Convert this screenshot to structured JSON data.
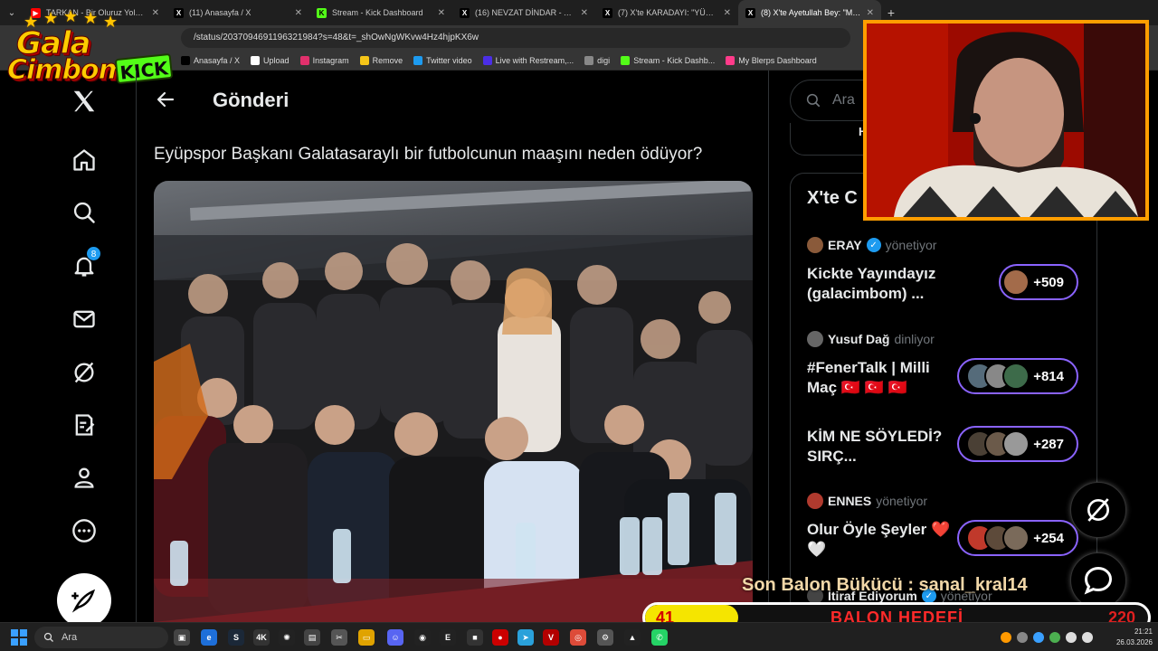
{
  "browser": {
    "tabs": [
      {
        "title": "TARKAN - Bir Oluruz Yolunda (C",
        "fav_text": "▶",
        "fav_color": "#ff0000"
      },
      {
        "title": "(11) Anasayfa / X",
        "fav_text": "X",
        "fav_color": "#000000"
      },
      {
        "title": "Stream - Kick Dashboard",
        "fav_text": "K",
        "fav_color": "#53fc18"
      },
      {
        "title": "(16) NEVZAT DİNDAR - Arama / X",
        "fav_text": "X",
        "fav_color": "#000000"
      },
      {
        "title": "(7) X'te KARADAYI: \"YÜKLEN PAYI",
        "fav_text": "X",
        "fav_color": "#000000"
      },
      {
        "title": "(8) X'te Ayetullah Bey: \"Milliyet",
        "fav_text": "X",
        "fav_color": "#000000"
      }
    ],
    "active_tab_index": 5,
    "url": "/status/2037094691196321984?s=48&t=_shOwNgWKvw4Hz4hjpKX6w",
    "bookmarks": [
      {
        "label": "Anasayfa / X",
        "icon": "x-icon",
        "color": "#000000"
      },
      {
        "label": "Upload",
        "icon": "upload-icon",
        "color": "#ffffff"
      },
      {
        "label": "Instagram",
        "icon": "instagram-icon",
        "color": "#e1306c"
      },
      {
        "label": "Remove",
        "icon": "folder-icon",
        "color": "#f5c518"
      },
      {
        "label": "Twitter video",
        "icon": "twitter-icon",
        "color": "#1d9bf0"
      },
      {
        "label": "Live with Restream,...",
        "icon": "restream-icon",
        "color": "#4b2ee6"
      },
      {
        "label": "digi",
        "icon": "grid-icon",
        "color": "#888888"
      },
      {
        "label": "Stream - Kick Dashb...",
        "icon": "kick-icon",
        "color": "#53fc18"
      },
      {
        "label": "My Blerps Dashboard",
        "icon": "blerp-icon",
        "color": "#ff3b8a"
      }
    ]
  },
  "overlay_logo": {
    "line1": "Gala",
    "line2": "Cimbom",
    "kick": "KICK"
  },
  "x_nav": {
    "items": [
      "x-logo-icon",
      "home-icon",
      "search-icon",
      "notifications-icon",
      "messages-icon",
      "grok-icon",
      "lists-icon",
      "profile-icon",
      "more-icon"
    ],
    "notification_count": "8"
  },
  "post": {
    "header_title": "Gönderi",
    "text": "Eyüpspor Başkanı Galatasaraylı bir futbolcunun maaşını neden ödüyor?"
  },
  "sidebar": {
    "search_placeholder": "Ara",
    "prev_card_fragment": "H",
    "spaces_title": "X'te C",
    "spaces": [
      {
        "host": "ERAY",
        "verified": true,
        "status": "yönetiyor",
        "title": "Kickte Yayındayız (galacimbom) ...",
        "count": "+509",
        "avatars": 1
      },
      {
        "host": "Yusuf Dağ",
        "verified": false,
        "status": "dinliyor",
        "title": "#FenerTalk | Milli Maç 🇹🇷 🇹🇷 🇹🇷",
        "count": "+814",
        "avatars": 3
      },
      {
        "host": "",
        "verified": false,
        "status": "",
        "title": "KİM NE SÖYLEDİ? SIRÇ...",
        "count": "+287",
        "avatars": 3
      },
      {
        "host": "ENNES",
        "verified": false,
        "status": "yönetiyor",
        "title": "Olur Öyle Şeyler ❤️🤍",
        "count": "+254",
        "avatars": 3
      },
      {
        "host": "İtiraf Ediyorum",
        "verified": true,
        "status": "yönetiyor",
        "title": "",
        "count": "",
        "avatars": 0
      }
    ]
  },
  "stream_overlay": {
    "last_bomb_text": "Son Balon Bükücü : sanal_kral14",
    "balloon_current": "41",
    "balloon_label": "BALON HEDEFİ",
    "balloon_goal": "220",
    "balloon_progress": 0.186
  },
  "taskbar": {
    "search_placeholder": "Ara",
    "time": "21:21",
    "date": "26.03.2026"
  }
}
